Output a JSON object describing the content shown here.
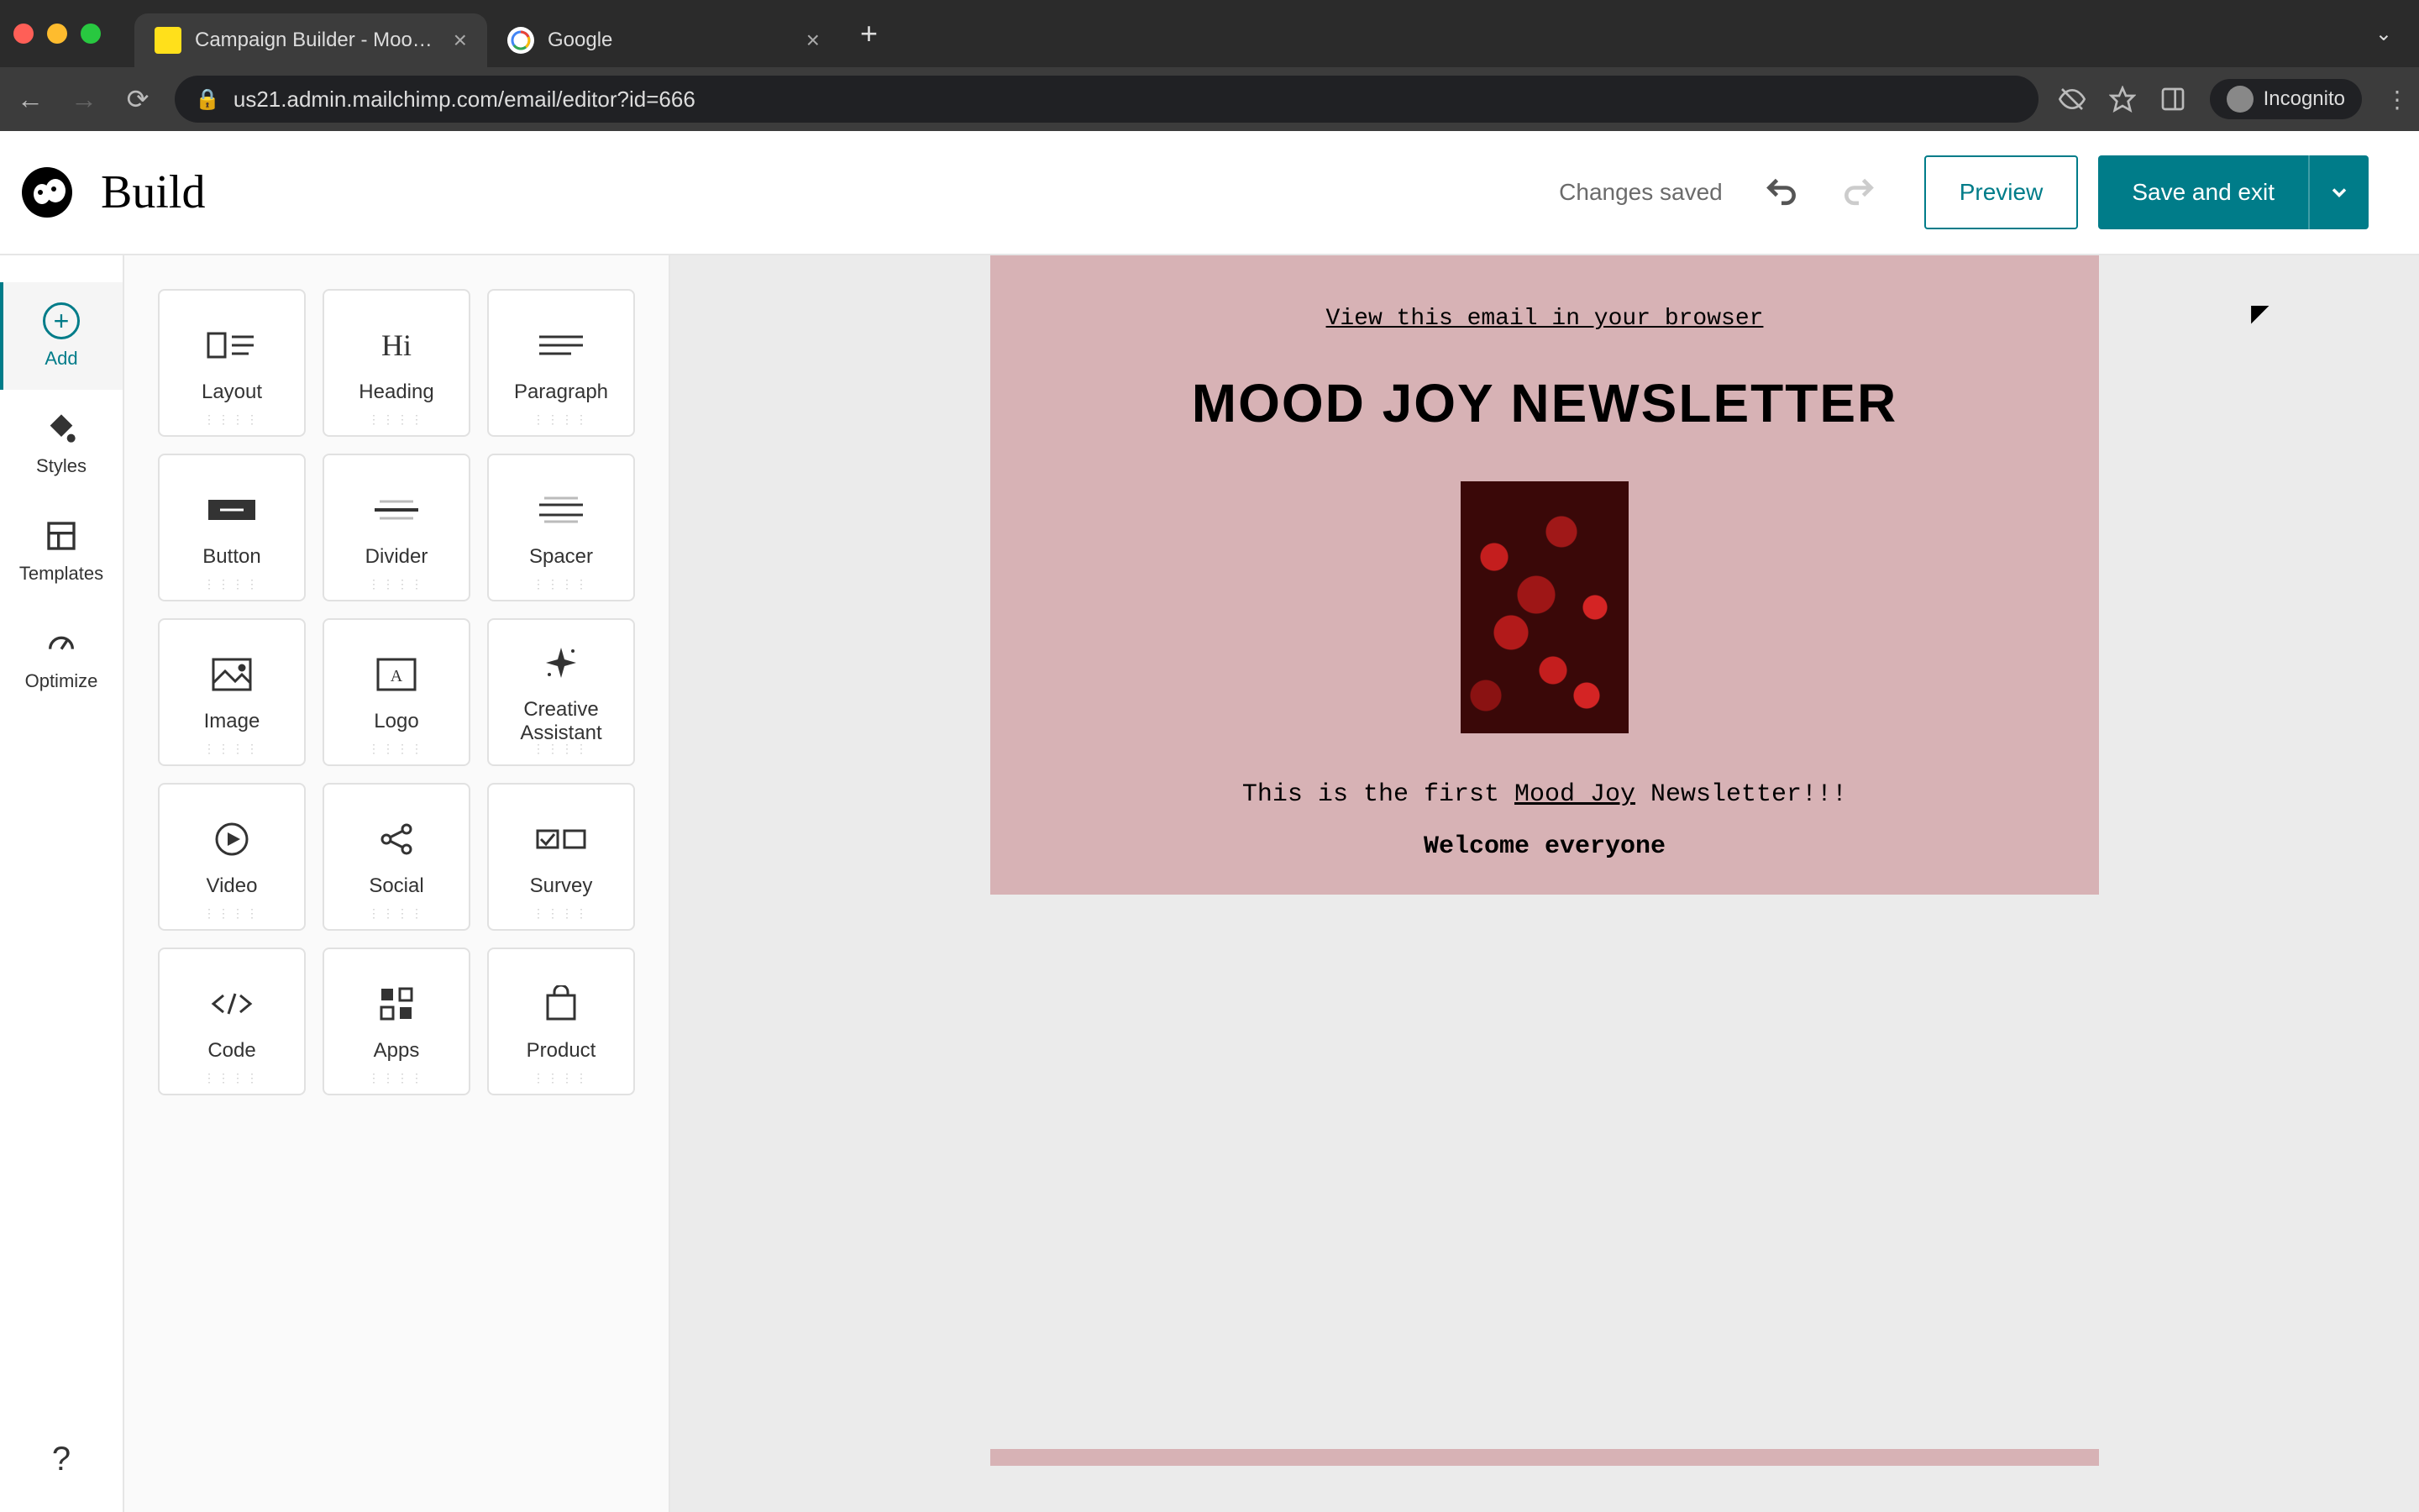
{
  "browser": {
    "tabs": [
      {
        "title": "Campaign Builder - Mood Joy",
        "active": true
      },
      {
        "title": "Google",
        "active": false
      }
    ],
    "url": "us21.admin.mailchimp.com/email/editor?id=666",
    "incognito_label": "Incognito"
  },
  "header": {
    "title": "Build",
    "status": "Changes saved",
    "preview_label": "Preview",
    "save_label": "Save and exit"
  },
  "rail": {
    "add": "Add",
    "styles": "Styles",
    "templates": "Templates",
    "optimize": "Optimize"
  },
  "blocks": [
    "Layout",
    "Heading",
    "Paragraph",
    "Button",
    "Divider",
    "Spacer",
    "Image",
    "Logo",
    "Creative\nAssistant",
    "Video",
    "Social",
    "Survey",
    "Code",
    "Apps",
    "Product"
  ],
  "email": {
    "view_link": "View this email in your browser",
    "heading": "MOOD JOY NEWSLETTER",
    "line_pre": "This is the first ",
    "line_link": "Mood Joy",
    "line_post": " Newsletter!!!",
    "welcome": "Welcome everyone"
  },
  "help": "?"
}
